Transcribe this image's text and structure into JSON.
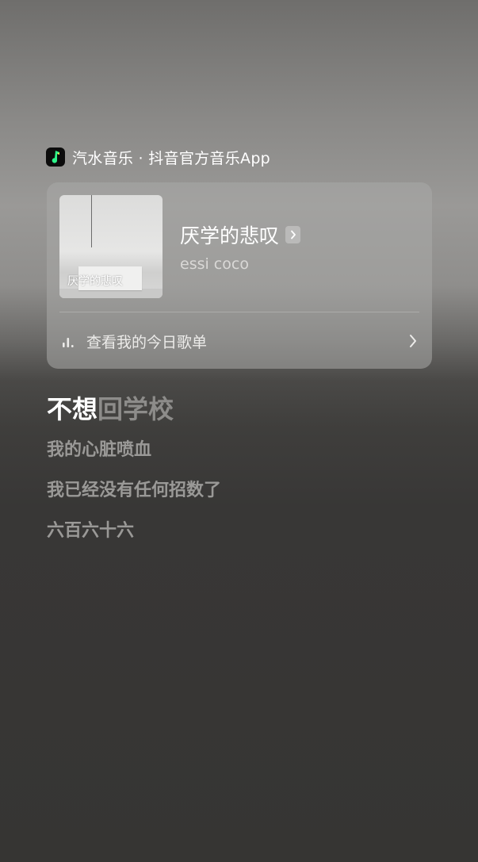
{
  "brand": {
    "name": "汽水音乐 · 抖音官方音乐App",
    "logo_icon": "music-note-icon",
    "logo_colors": [
      "#2ef48a",
      "#f5e94a"
    ]
  },
  "card": {
    "cover_text": "厌学的悲叹",
    "title": "厌学的悲叹",
    "artist": "essi coco",
    "playlist_label": "查看我的今日歌单"
  },
  "lyrics": {
    "current_sung": "不想",
    "current_unsung": "回学校",
    "lines": [
      "我的心脏喷血",
      "我已经没有任何招数了",
      "六百六十六"
    ]
  }
}
